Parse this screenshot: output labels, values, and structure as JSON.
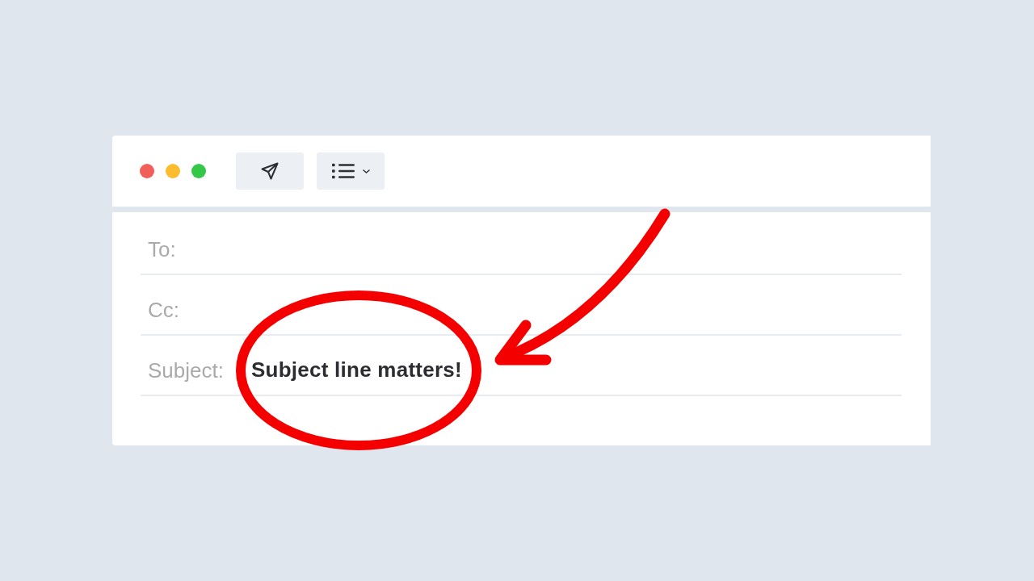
{
  "window_controls": [
    {
      "color": "#f25f58"
    },
    {
      "color": "#fbbd2e"
    },
    {
      "color": "#35c748"
    }
  ],
  "toolbar": {
    "buttons": [
      {
        "kind": "send",
        "dropdown": false
      },
      {
        "kind": "list",
        "dropdown": true
      }
    ]
  },
  "fields": [
    {
      "label": "To:",
      "highlighted": false
    },
    {
      "label": "Cc:",
      "highlighted": false
    },
    {
      "label": "Subject:",
      "value": "Subject line matters!",
      "highlighted": true
    }
  ]
}
